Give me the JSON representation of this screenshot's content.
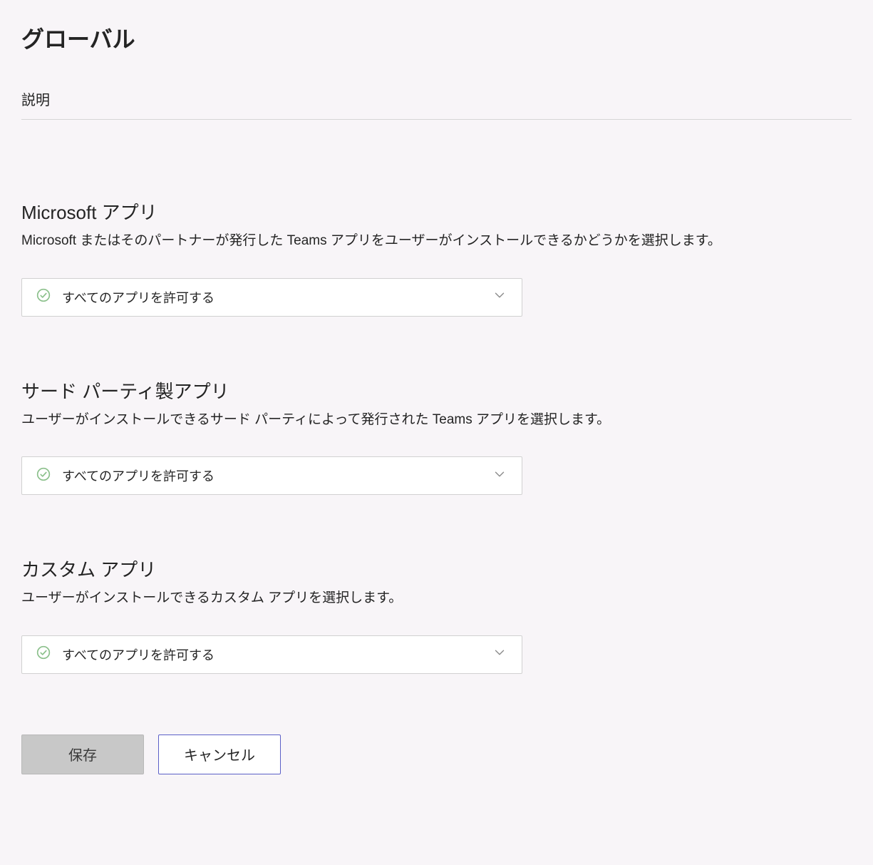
{
  "page": {
    "title": "グローバル",
    "description_label": "説明"
  },
  "sections": {
    "microsoft": {
      "title": "Microsoft アプリ",
      "desc": "Microsoft またはそのパートナーが発行した Teams アプリをユーザーがインストールできるかどうかを選択します。",
      "selected": "すべてのアプリを許可する"
    },
    "thirdparty": {
      "title": "サード パーティ製アプリ",
      "desc": "ユーザーがインストールできるサード パーティによって発行された Teams アプリを選択します。",
      "selected": "すべてのアプリを許可する"
    },
    "custom": {
      "title": "カスタム アプリ",
      "desc": "ユーザーがインストールできるカスタム アプリを選択します。",
      "selected": "すべてのアプリを許可する"
    }
  },
  "buttons": {
    "save": "保存",
    "cancel": "キャンセル"
  }
}
